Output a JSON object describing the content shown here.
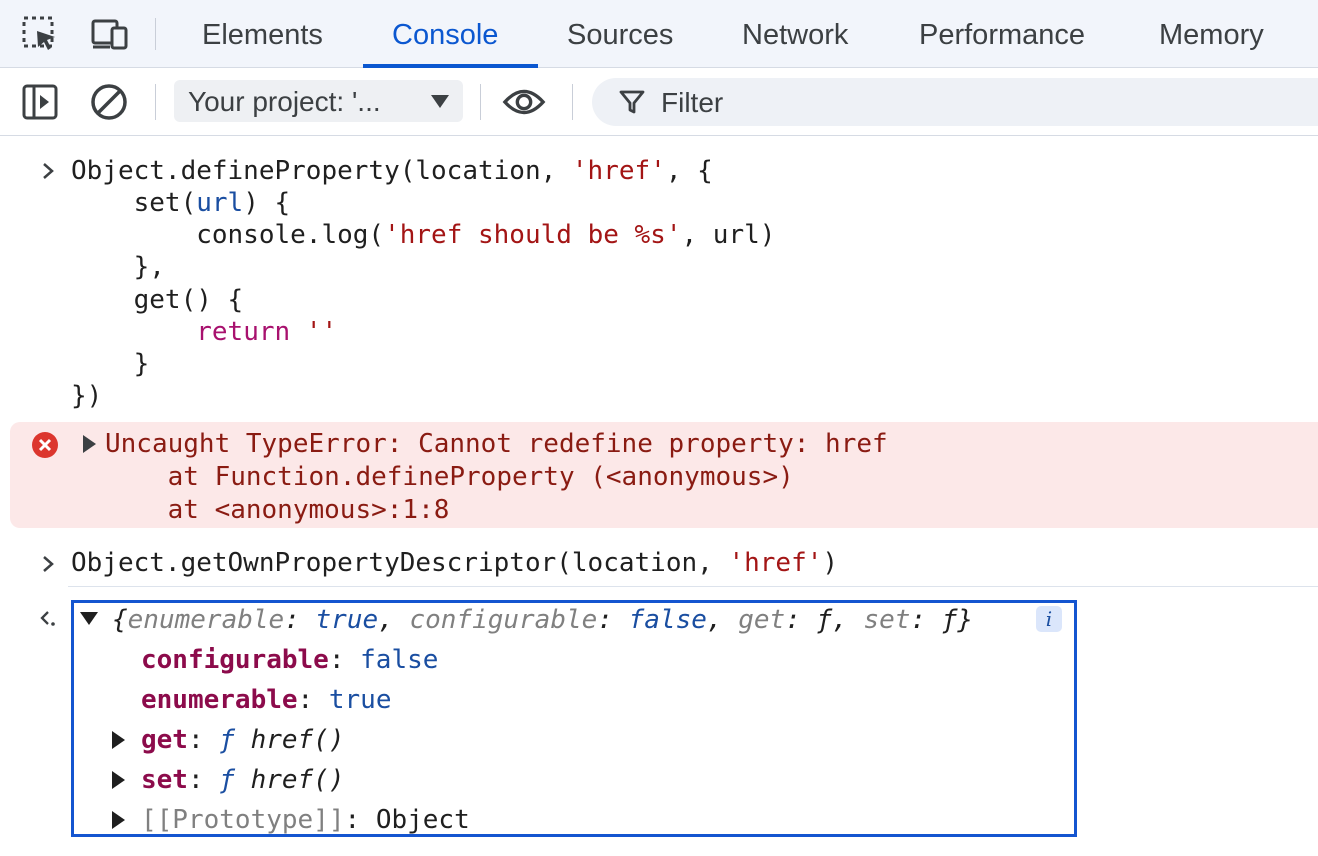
{
  "tabs": {
    "items": [
      {
        "label": "Elements"
      },
      {
        "label": "Console"
      },
      {
        "label": "Sources"
      },
      {
        "label": "Network"
      },
      {
        "label": "Performance"
      },
      {
        "label": "Memory"
      }
    ],
    "active": "Console"
  },
  "toolbar": {
    "context_select": "Your project: '...",
    "filter_placeholder": "Filter"
  },
  "icons": {
    "inspect": "inspect-element-icon",
    "device": "device-toolbar-icon",
    "sidebar": "sidebar-toggle-icon",
    "clear": "clear-console-icon",
    "eye": "live-expression-icon",
    "filter": "filter-icon",
    "error": "error-icon"
  },
  "console": {
    "input1": {
      "l1": {
        "a": "Object.defineProperty(location, ",
        "b": "'href'",
        "c": ", {"
      },
      "l2": {
        "a": "    set(",
        "b": "url",
        "c": ") {"
      },
      "l3": {
        "a": "        console.log(",
        "b": "'href should be %s'",
        "c": ", url)"
      },
      "l4": "    },",
      "l5": "    get() {",
      "l6": {
        "a": "        ",
        "b": "return",
        "c": " ",
        "d": "''"
      },
      "l7": "    }",
      "l8": "})"
    },
    "error": {
      "message": "Uncaught TypeError: Cannot redefine property: href",
      "stack1": "    at Function.defineProperty (<anonymous>)",
      "stack2": "    at <anonymous>:1:8"
    },
    "input2": {
      "a": "Object.getOwnPropertyDescriptor(location, ",
      "b": "'href'",
      "c": ")"
    },
    "result": {
      "summary": {
        "open": "{",
        "k1": "enumerable",
        "v1": "true",
        "k2": "configurable",
        "v2": "false",
        "k3": "get",
        "v3": "ƒ",
        "k4": "set",
        "v4": "ƒ",
        "close": "}",
        "colon": ": ",
        "comma": ", "
      },
      "info": "i",
      "props": [
        {
          "key": "configurable",
          "value": "false"
        },
        {
          "key": "enumerable",
          "value": "true"
        },
        {
          "key": "get",
          "f": "ƒ",
          "value": "href()"
        },
        {
          "key": "set",
          "f": "ƒ",
          "value": "href()"
        },
        {
          "key": "[[Prototype]]",
          "value": "Object"
        }
      ],
      "colon": ": "
    }
  },
  "colors": {
    "accent": "#0b57d0",
    "error_bg": "#fce8e8",
    "error_text": "#8a1b12",
    "string": "#a31515",
    "highlight_border": "#1455d0"
  }
}
